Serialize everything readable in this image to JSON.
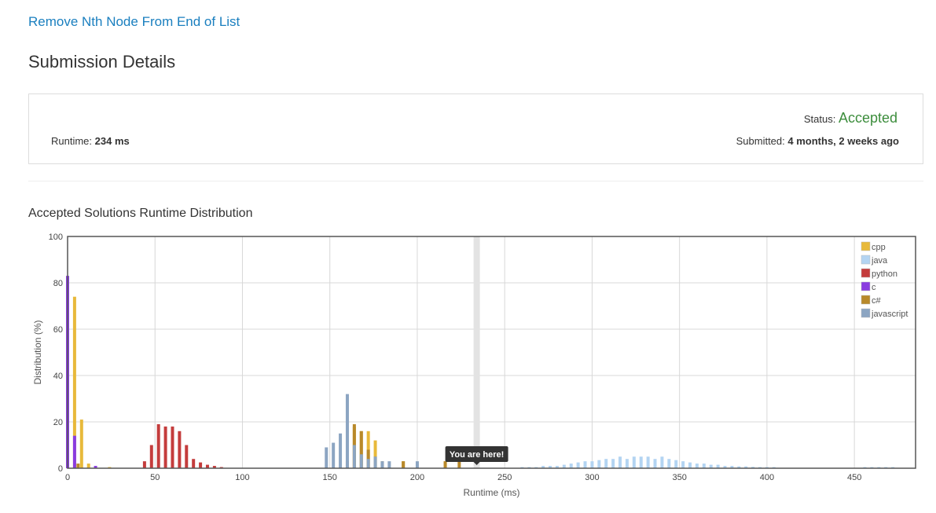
{
  "header": {
    "problem_title": "Remove Nth Node From End of List",
    "page_title": "Submission Details"
  },
  "submission": {
    "runtime_label": "Runtime:",
    "runtime_value": "234 ms",
    "status_label": "Status:",
    "status_value": "Accepted",
    "submitted_label": "Submitted:",
    "submitted_value": "4 months, 2 weeks ago"
  },
  "chart_title": "Accepted Solutions Runtime Distribution",
  "colors": {
    "cpp": "#e8b93a",
    "java": "#b3d4f2",
    "python": "#c43c3c",
    "c": "#8a3ce0",
    "c#": "#b8892a",
    "javascript": "#8ca5c2",
    "accepted": "#3c8d3c",
    "link": "#1a7fbf"
  },
  "chart_data": {
    "type": "bar",
    "xlabel": "Runtime (ms)",
    "ylabel": "Distribution (%)",
    "xlim": [
      0,
      485
    ],
    "ylim": [
      0,
      100
    ],
    "xticks": [
      0,
      50,
      100,
      150,
      200,
      250,
      300,
      350,
      400,
      450
    ],
    "yticks": [
      0,
      20,
      40,
      60,
      80,
      100
    ],
    "grid": true,
    "legend_position": "top-right",
    "you_are_here": {
      "x": 234,
      "label": "You are here!"
    },
    "series": [
      {
        "name": "cpp",
        "points": [
          [
            4,
            74
          ],
          [
            8,
            21
          ],
          [
            12,
            2
          ],
          [
            24,
            0.5
          ],
          [
            164,
            18
          ],
          [
            168,
            16
          ],
          [
            172,
            16
          ],
          [
            176,
            12
          ],
          [
            192,
            3
          ],
          [
            216,
            3
          ]
        ]
      },
      {
        "name": "java",
        "points": [
          [
            260,
            0.5
          ],
          [
            264,
            0.5
          ],
          [
            268,
            0.5
          ],
          [
            272,
            1
          ],
          [
            276,
            1
          ],
          [
            280,
            1
          ],
          [
            284,
            1.5
          ],
          [
            288,
            2
          ],
          [
            292,
            2.5
          ],
          [
            296,
            3
          ],
          [
            300,
            3
          ],
          [
            304,
            3.5
          ],
          [
            308,
            4
          ],
          [
            312,
            4
          ],
          [
            316,
            5
          ],
          [
            320,
            4
          ],
          [
            324,
            5
          ],
          [
            328,
            5
          ],
          [
            332,
            5
          ],
          [
            336,
            4
          ],
          [
            340,
            5
          ],
          [
            344,
            4
          ],
          [
            348,
            3.5
          ],
          [
            352,
            3
          ],
          [
            356,
            2.5
          ],
          [
            360,
            2
          ],
          [
            364,
            2
          ],
          [
            368,
            1.5
          ],
          [
            372,
            1.5
          ],
          [
            376,
            1
          ],
          [
            380,
            1
          ],
          [
            384,
            0.8
          ],
          [
            388,
            0.8
          ],
          [
            392,
            0.6
          ],
          [
            396,
            0.5
          ],
          [
            400,
            0.5
          ],
          [
            404,
            0.5
          ],
          [
            456,
            0.5
          ],
          [
            460,
            0.5
          ],
          [
            464,
            0.5
          ],
          [
            468,
            0.5
          ],
          [
            472,
            0.5
          ]
        ]
      },
      {
        "name": "python",
        "points": [
          [
            44,
            3
          ],
          [
            48,
            10
          ],
          [
            52,
            19
          ],
          [
            56,
            18
          ],
          [
            60,
            18
          ],
          [
            64,
            16
          ],
          [
            68,
            10
          ],
          [
            72,
            4
          ],
          [
            76,
            2.5
          ],
          [
            80,
            1.5
          ],
          [
            84,
            1
          ],
          [
            88,
            0.5
          ]
        ]
      },
      {
        "name": "c",
        "points": [
          [
            0,
            83
          ],
          [
            4,
            14
          ],
          [
            16,
            1
          ]
        ]
      },
      {
        "name": "c#",
        "points": [
          [
            6,
            2
          ],
          [
            160,
            3
          ],
          [
            164,
            19
          ],
          [
            168,
            16
          ],
          [
            172,
            8
          ],
          [
            176,
            5
          ],
          [
            180,
            3
          ],
          [
            192,
            3
          ],
          [
            216,
            3
          ],
          [
            224,
            3
          ]
        ]
      },
      {
        "name": "javascript",
        "points": [
          [
            148,
            9
          ],
          [
            152,
            11
          ],
          [
            156,
            15
          ],
          [
            160,
            32
          ],
          [
            164,
            10
          ],
          [
            168,
            6
          ],
          [
            172,
            4
          ],
          [
            176,
            5
          ],
          [
            180,
            3
          ],
          [
            184,
            3
          ],
          [
            200,
            3
          ]
        ]
      }
    ]
  }
}
